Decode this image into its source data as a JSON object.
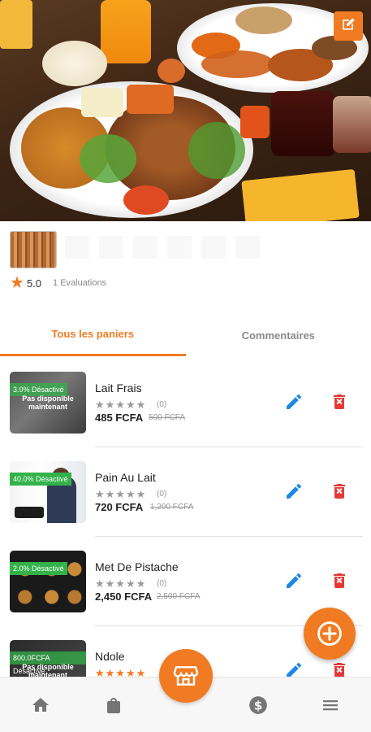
{
  "colors": {
    "accent": "#f07b22",
    "success": "#33b24a",
    "edit": "#1e88e5",
    "delete": "#e53935",
    "muted": "#8a8a8a"
  },
  "hero": {
    "edit_icon": "edit-square-icon"
  },
  "store": {
    "rating": "5.0",
    "rating_count": "1 Evaluations",
    "star_icon": "star-icon"
  },
  "tabs": [
    {
      "label": "Tous les paniers",
      "active": true
    },
    {
      "label": "Commentaires",
      "active": false
    }
  ],
  "products": [
    {
      "name": "Lait Frais",
      "stars": "★★★★★",
      "stars_filled": 0,
      "rating_count": "(0)",
      "price": "485 FCFA",
      "old_price": "500 FCFA",
      "badge": "3.0% Désactivé",
      "overlay": "Pas disponible maintenant"
    },
    {
      "name": "Pain Au Lait",
      "stars": "★★★★★",
      "stars_filled": 0,
      "rating_count": "(0)",
      "price": "720 FCFA",
      "old_price": "1,200 FCFA",
      "badge": "40.0% Désactivé",
      "overlay": ""
    },
    {
      "name": "Met De Pistache",
      "stars": "★★★★★",
      "stars_filled": 0,
      "rating_count": "(0)",
      "price": "2,450 FCFA",
      "old_price": "2,500 FCFA",
      "badge": "2.0% Désactivé",
      "overlay": ""
    },
    {
      "name": "Ndole",
      "stars": "★★★★★",
      "stars_filled": 5,
      "rating_count": "",
      "price": "",
      "old_price": "",
      "badge": "800.0FCFA Désactivé",
      "overlay": "Pas disponible maintenant"
    }
  ],
  "fab": {
    "icon": "plus-circle-icon"
  },
  "bottom_nav": [
    {
      "icon": "home-icon"
    },
    {
      "icon": "shopping-bag-icon"
    },
    {
      "icon": "store-icon"
    },
    {
      "icon": "dollar-icon"
    },
    {
      "icon": "menu-icon"
    }
  ]
}
